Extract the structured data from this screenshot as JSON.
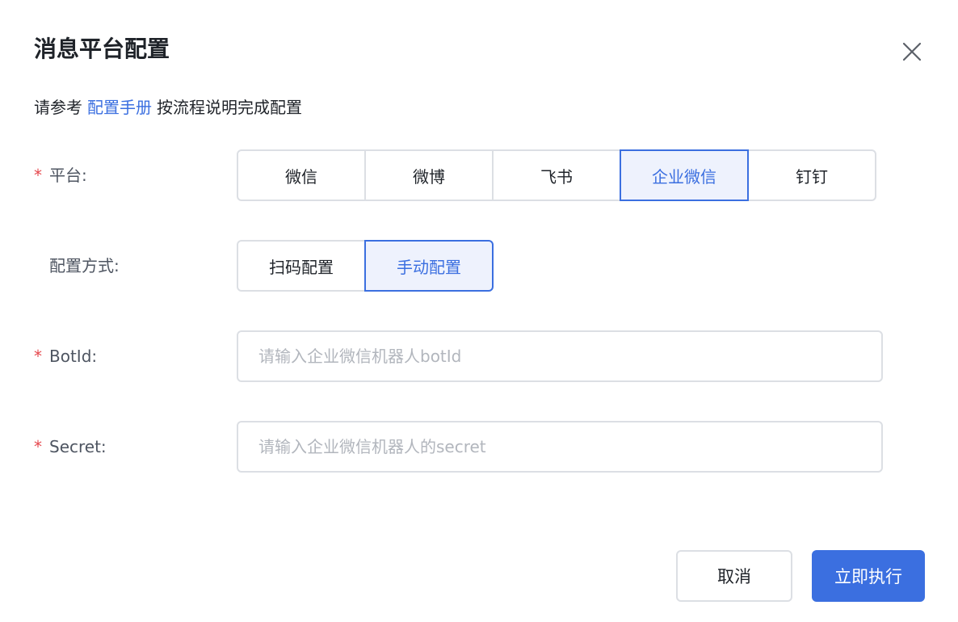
{
  "dialog": {
    "title": "消息平台配置",
    "close_icon": "close-icon"
  },
  "intro": {
    "prefix": "请参考",
    "link": "配置手册",
    "suffix": "按流程说明完成配置"
  },
  "platform": {
    "required_mark": "*",
    "label": "平台:",
    "options": [
      "微信",
      "微博",
      "飞书",
      "企业微信",
      "钉钉"
    ],
    "selected": "企业微信"
  },
  "config_mode": {
    "label": "配置方式:",
    "options": [
      "扫码配置",
      "手动配置"
    ],
    "selected": "手动配置"
  },
  "botid": {
    "required_mark": "*",
    "label": "BotId:",
    "value": "",
    "placeholder": "请输入企业微信机器人botId"
  },
  "secret": {
    "required_mark": "*",
    "label": "Secret:",
    "value": "",
    "placeholder": "请输入企业微信机器人的secret"
  },
  "footer": {
    "cancel_label": "取消",
    "submit_label": "立即执行"
  },
  "colors": {
    "accent": "#3b6fe0",
    "required": "#e5484d",
    "border": "#dcdfe4",
    "active_bg": "#eef2fd",
    "placeholder": "#b2b6bd"
  }
}
